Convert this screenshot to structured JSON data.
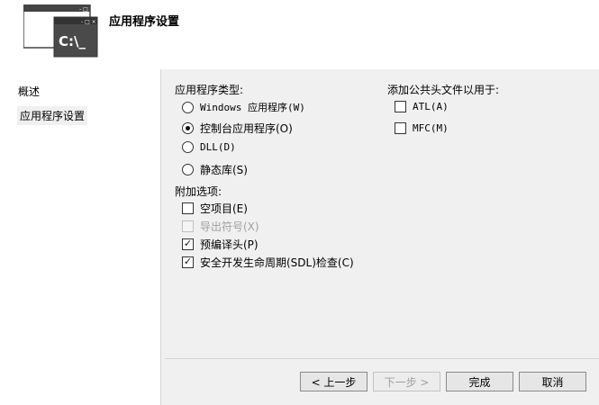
{
  "header": {
    "title": "应用程序设置",
    "logo_text": "C:\\_"
  },
  "sidebar": {
    "items": [
      {
        "label": "概述"
      },
      {
        "label": "应用程序设置"
      }
    ]
  },
  "app_type": {
    "label": "应用程序类型:",
    "options": [
      {
        "label": "Windows 应用程序(W)",
        "checked": false
      },
      {
        "label": "控制台应用程序(O)",
        "checked": true
      },
      {
        "label": "DLL(D)",
        "checked": false
      },
      {
        "label": "静态库(S)",
        "checked": false
      }
    ]
  },
  "extra": {
    "label": "附加选项:",
    "options": [
      {
        "label": "空项目(E)",
        "checked": false,
        "disabled": false
      },
      {
        "label": "导出符号(X)",
        "checked": false,
        "disabled": true
      },
      {
        "label": "预编译头(P)",
        "checked": true,
        "disabled": false
      },
      {
        "label": "安全开发生命周期(SDL)检查(C)",
        "checked": true,
        "disabled": false
      }
    ]
  },
  "common_headers": {
    "label": "添加公共头文件以用于:",
    "options": [
      {
        "label": "ATL(A)",
        "checked": false
      },
      {
        "label": "MFC(M)",
        "checked": false
      }
    ]
  },
  "buttons": {
    "back": "< 上一步",
    "next": "下一步 >",
    "finish": "完成",
    "cancel": "取消"
  }
}
